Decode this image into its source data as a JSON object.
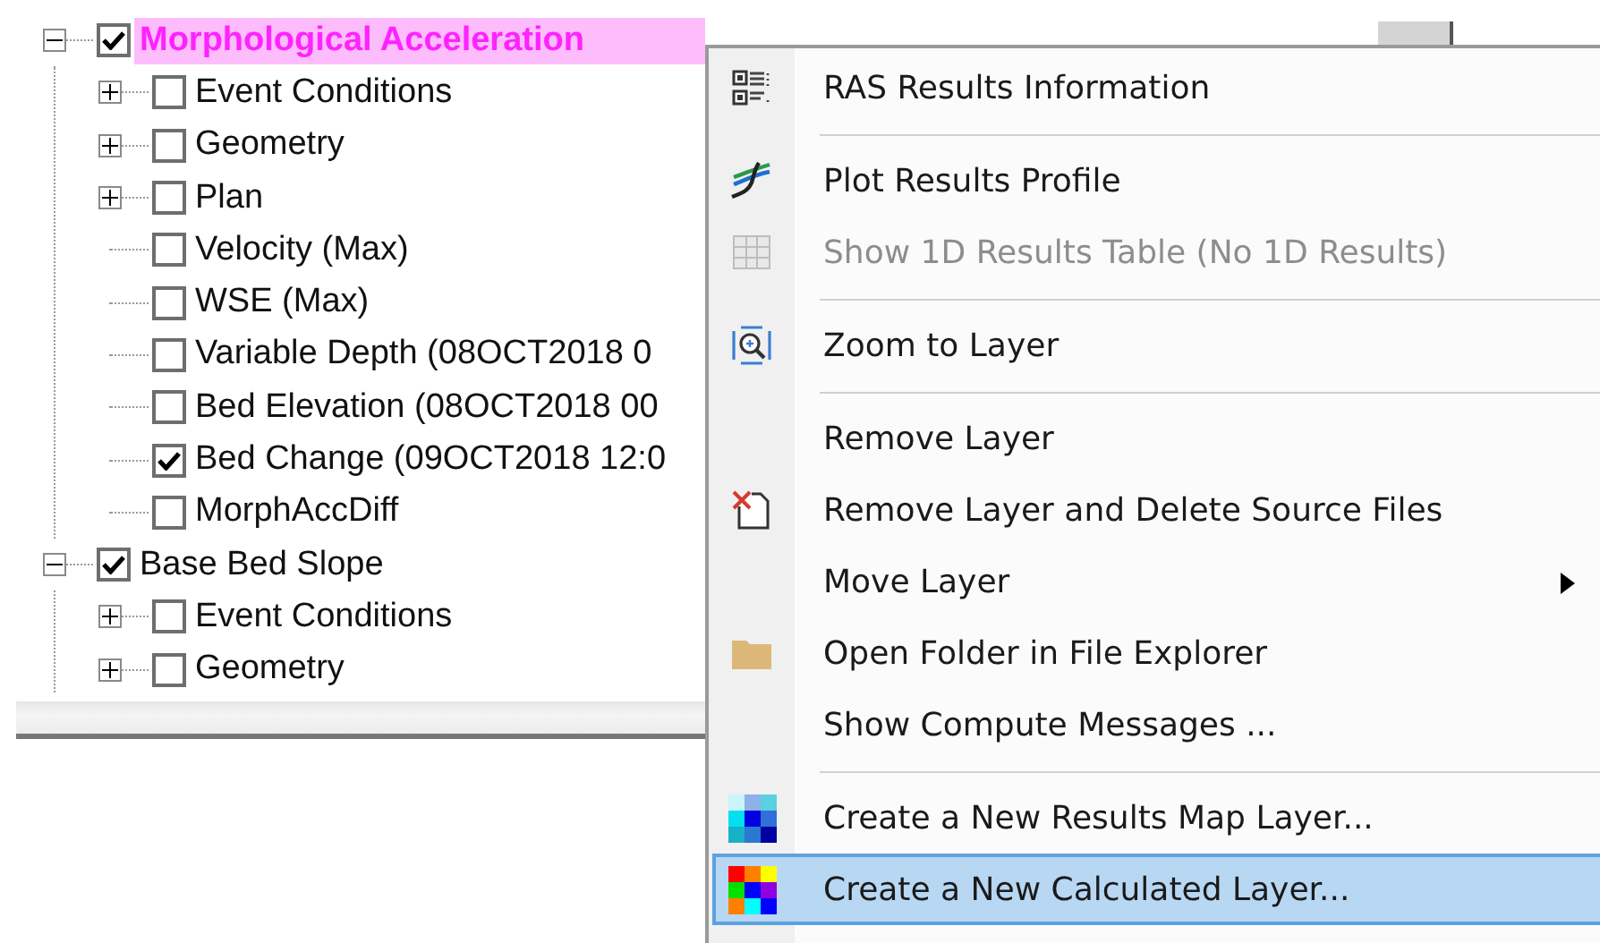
{
  "layers": [
    {
      "label": "Morphological Acceleration",
      "checked": true,
      "expanded": true,
      "selected": true,
      "children": [
        {
          "label": "Event Conditions",
          "checked": false,
          "expanded": false,
          "selected": false
        },
        {
          "label": "Geometry",
          "checked": false,
          "expanded": false,
          "selected": false
        },
        {
          "label": "Plan",
          "checked": false,
          "expanded": false,
          "selected": false
        },
        {
          "label": "Velocity (Max)",
          "checked": false,
          "selected": false
        },
        {
          "label": "WSE (Max)",
          "checked": false,
          "selected": false
        },
        {
          "label": "Variable Depth (08OCT2018 0",
          "checked": false,
          "selected": false
        },
        {
          "label": "Bed Elevation (08OCT2018 00",
          "checked": false,
          "selected": false
        },
        {
          "label": "Bed Change (09OCT2018 12:0",
          "checked": true,
          "selected": false
        },
        {
          "label": "MorphAccDiff",
          "checked": false,
          "selected": false
        }
      ]
    },
    {
      "label": "Base Bed Slope",
      "checked": true,
      "expanded": true,
      "selected": false,
      "children": [
        {
          "label": "Event Conditions",
          "checked": false,
          "expanded": false,
          "selected": false
        },
        {
          "label": "Geometry",
          "checked": false,
          "expanded": false,
          "selected": false
        }
      ]
    }
  ],
  "context_menu": [
    {
      "kind": "info",
      "label": "RAS Results Information",
      "disabled": false,
      "selected": false
    },
    {
      "kind": "separator"
    },
    {
      "kind": "profile",
      "label": "Plot Results Profile",
      "disabled": false,
      "selected": false
    },
    {
      "kind": "table",
      "label": "Show 1D Results Table (No 1D Results)",
      "disabled": true,
      "selected": false
    },
    {
      "kind": "separator"
    },
    {
      "kind": "zoom",
      "label": "Zoom to Layer",
      "disabled": false,
      "selected": false
    },
    {
      "kind": "separator"
    },
    {
      "kind": "plain",
      "label": "Remove Layer",
      "disabled": false,
      "selected": false
    },
    {
      "kind": "delete",
      "label": "Remove Layer and Delete Source Files",
      "disabled": false,
      "selected": false
    },
    {
      "kind": "plain",
      "label": "Move Layer",
      "disabled": false,
      "selected": false,
      "submenu": true
    },
    {
      "kind": "folder",
      "label": "Open Folder in File Explorer",
      "disabled": false,
      "selected": false
    },
    {
      "kind": "plain",
      "label": "Show Compute Messages ...",
      "disabled": false,
      "selected": false
    },
    {
      "kind": "separator"
    },
    {
      "kind": "map",
      "label": "Create a New Results Map Layer...",
      "disabled": false,
      "selected": false
    },
    {
      "kind": "calc",
      "label": "Create a New Calculated Layer...",
      "disabled": false,
      "selected": true
    }
  ]
}
